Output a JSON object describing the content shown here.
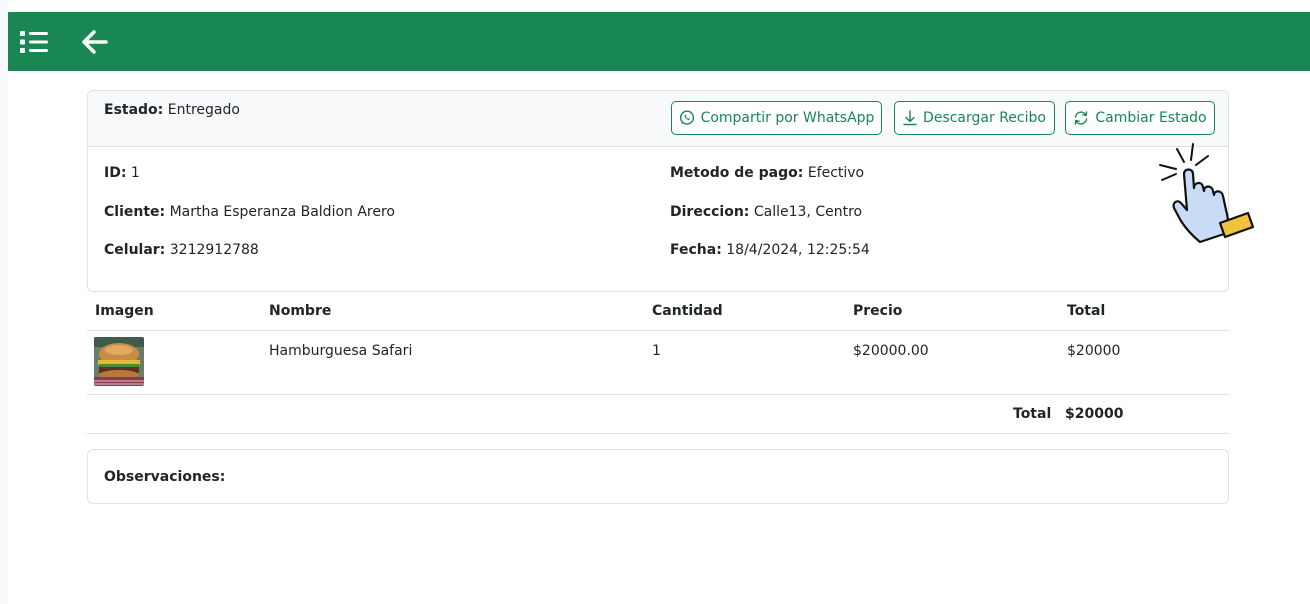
{
  "topbar": {
    "menu_icon": "list-icon",
    "back_icon": "arrow-left-icon",
    "color": "#198754"
  },
  "order": {
    "status_label": "Estado:",
    "status_value": "Entregado",
    "buttons": {
      "whatsapp": "Compartir por WhatsApp",
      "download": "Descargar Recibo",
      "change_state": "Cambiar Estado"
    },
    "id_label": "ID:",
    "id_value": "1",
    "client_label": "Cliente:",
    "client_value": "Martha Esperanza Baldion Arero",
    "phone_label": "Celular:",
    "phone_value": "3212912788",
    "payment_label": "Metodo de pago:",
    "payment_value": "Efectivo",
    "address_label": "Direccion:",
    "address_value": "Calle13, Centro",
    "date_label": "Fecha:",
    "date_value": "18/4/2024, 12:25:54"
  },
  "table": {
    "headers": [
      "Imagen",
      "Nombre",
      "Cantidad",
      "Precio",
      "Total"
    ],
    "rows": [
      {
        "name": "Hamburguesa Safari",
        "quantity": "1",
        "price": "$20000.00",
        "total": "$20000"
      }
    ],
    "total_label": "Total",
    "total_value": "$20000"
  },
  "observations": {
    "label": "Observaciones:"
  },
  "colors": {
    "accent": "#198754",
    "border": "#dee2e6",
    "header_bg": "#f8f9fa"
  }
}
